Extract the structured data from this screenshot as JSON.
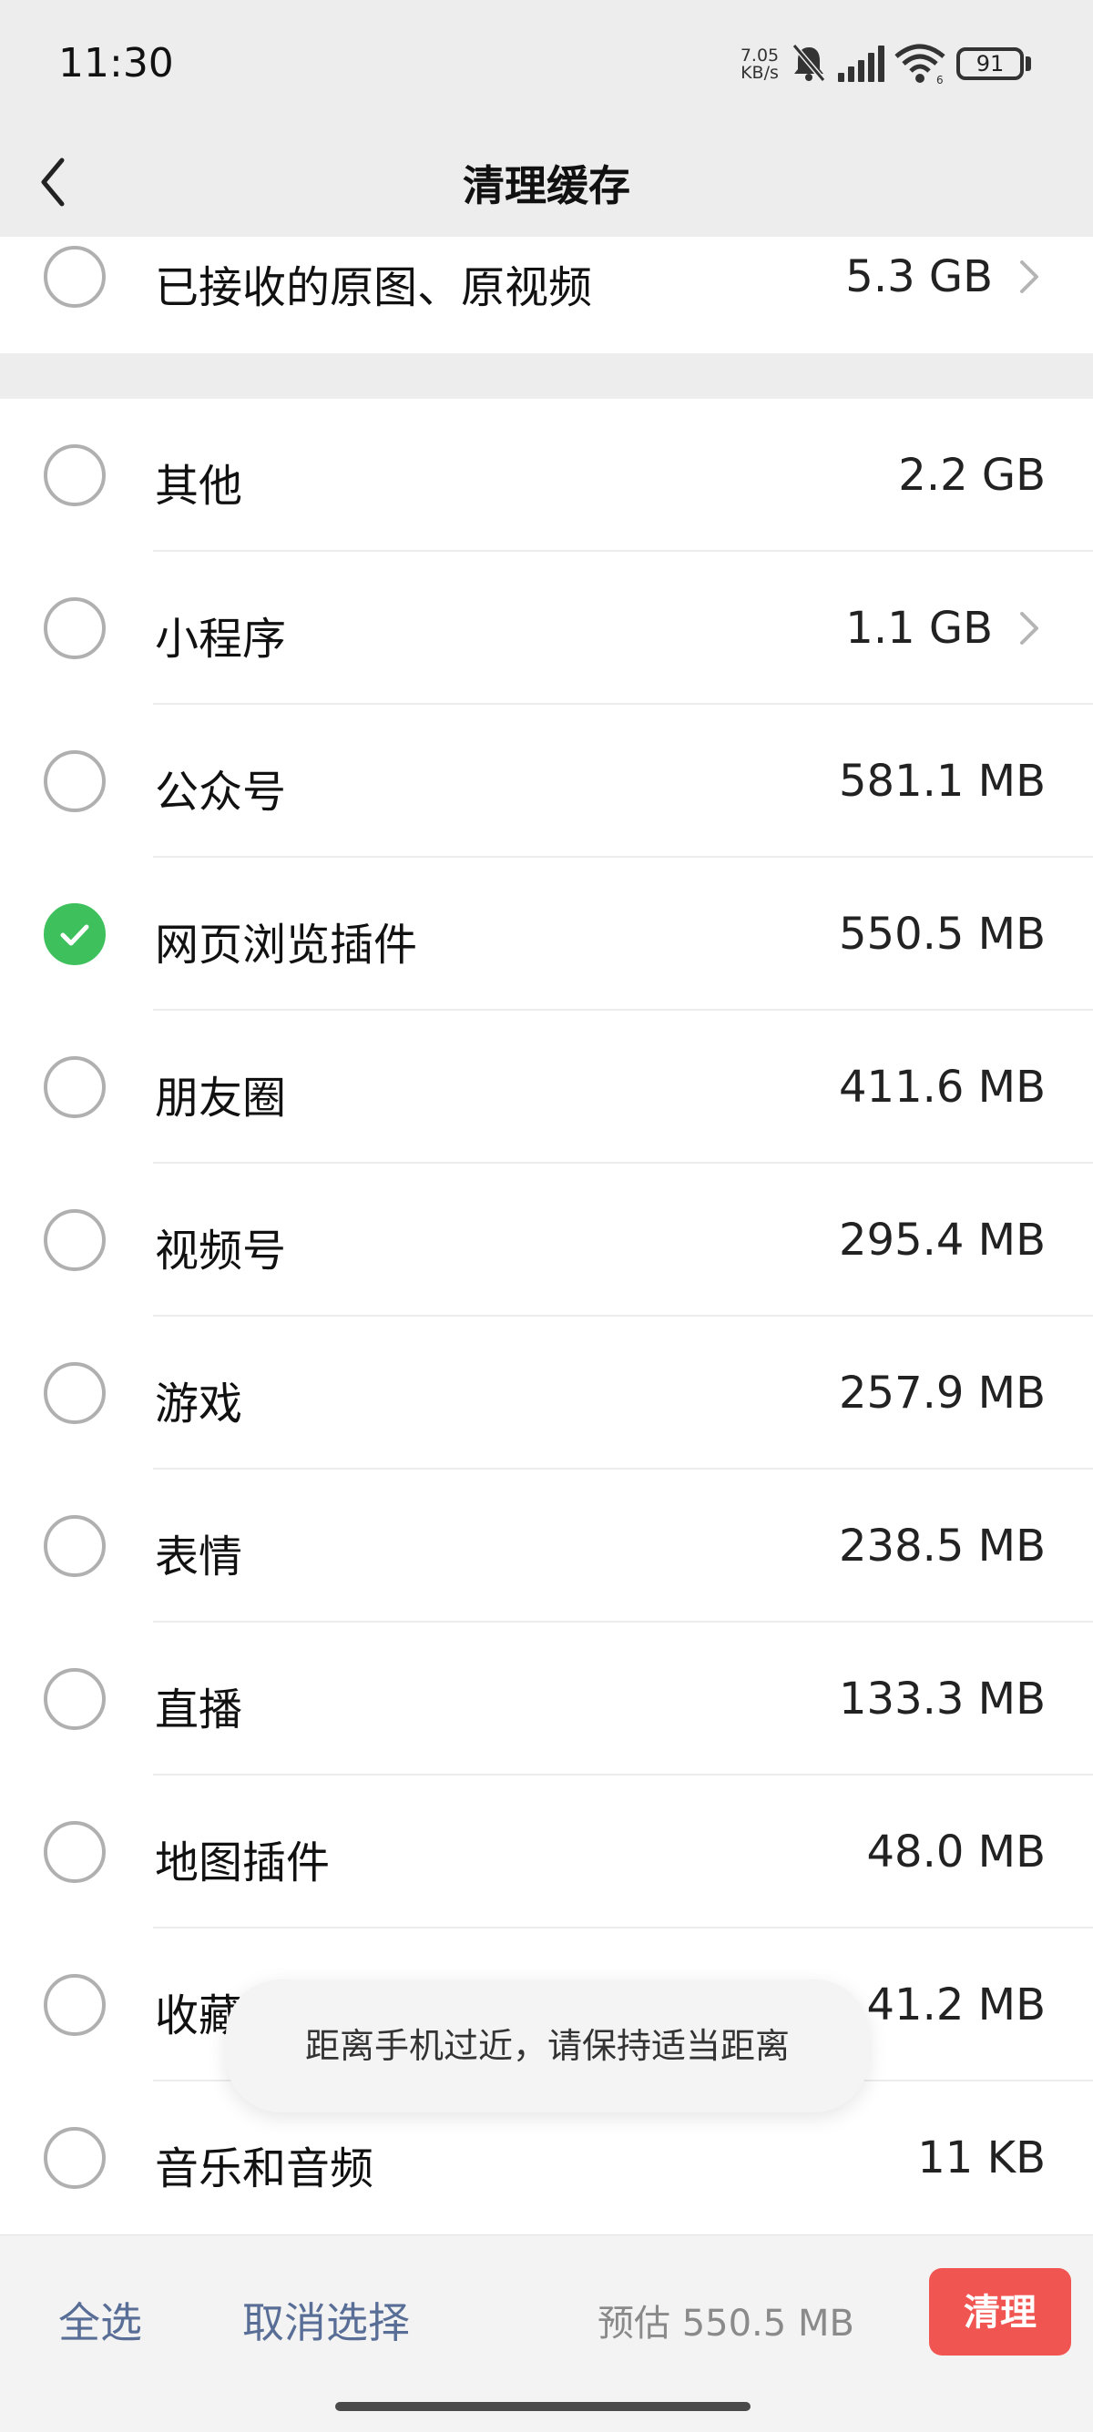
{
  "status_bar": {
    "time": "11:30",
    "net_speed_value": "7.05",
    "net_speed_unit": "KB/s",
    "battery": "91"
  },
  "header": {
    "title": "清理缓存"
  },
  "top_item": {
    "label": "已接收的原图、原视频",
    "size": "5.3 GB"
  },
  "items": [
    {
      "label": "其他",
      "size": "2.2 GB",
      "checked": false,
      "chevron": false
    },
    {
      "label": "小程序",
      "size": "1.1 GB",
      "checked": false,
      "chevron": true
    },
    {
      "label": "公众号",
      "size": "581.1 MB",
      "checked": false,
      "chevron": false
    },
    {
      "label": "网页浏览插件",
      "size": "550.5 MB",
      "checked": true,
      "chevron": false
    },
    {
      "label": "朋友圈",
      "size": "411.6 MB",
      "checked": false,
      "chevron": false
    },
    {
      "label": "视频号",
      "size": "295.4 MB",
      "checked": false,
      "chevron": false
    },
    {
      "label": "游戏",
      "size": "257.9 MB",
      "checked": false,
      "chevron": false
    },
    {
      "label": "表情",
      "size": "238.5 MB",
      "checked": false,
      "chevron": false
    },
    {
      "label": "直播",
      "size": "133.3 MB",
      "checked": false,
      "chevron": false
    },
    {
      "label": "地图插件",
      "size": "48.0 MB",
      "checked": false,
      "chevron": false
    },
    {
      "label": "收藏",
      "size": "41.2 MB",
      "checked": false,
      "chevron": false
    },
    {
      "label": "音乐和音频",
      "size": "11 KB",
      "checked": false,
      "chevron": false
    }
  ],
  "toast": "距离手机过近，请保持适当距离",
  "bottom_bar": {
    "select_all": "全选",
    "deselect": "取消选择",
    "estimate": "预估 550.5 MB",
    "clean_button": "清理"
  },
  "colors": {
    "accent_green": "#3ec15c",
    "action_red": "#f15552",
    "link_blue": "#596e97"
  }
}
